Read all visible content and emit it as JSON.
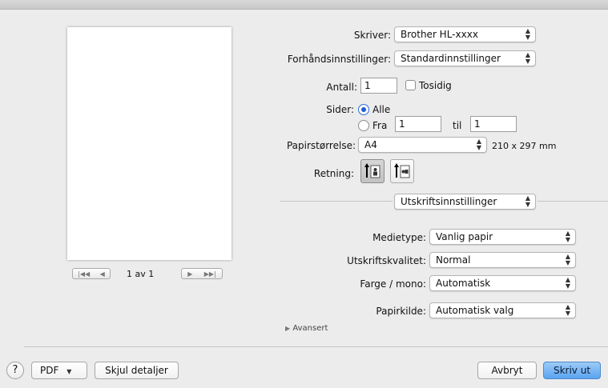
{
  "preview": {
    "page_indicator": "1 av 1",
    "first_label": "|◀◀",
    "prev_label": "◀",
    "next_label": "▶",
    "last_label": "▶▶|"
  },
  "printer": {
    "label": "Skriver:",
    "value": "Brother HL-xxxx"
  },
  "presets": {
    "label": "Forhåndsinnstillinger:",
    "value": "Standardinnstillinger"
  },
  "copies": {
    "label": "Antall:",
    "value": "1",
    "duplex_label": "Tosidig",
    "duplex_checked": false
  },
  "pages": {
    "label": "Sider:",
    "all_label": "Alle",
    "from_label": "Fra",
    "from_value": "1",
    "to_label": "til",
    "to_value": "1",
    "selected": "all"
  },
  "paper_size": {
    "label": "Papirstørrelse:",
    "value": "A4",
    "dimensions": "210 x 297 mm"
  },
  "orientation": {
    "label": "Retning:",
    "selected": "portrait"
  },
  "section": {
    "value": "Utskriftsinnstillinger"
  },
  "media_type": {
    "label": "Medietype:",
    "value": "Vanlig papir"
  },
  "quality": {
    "label": "Utskriftskvalitet:",
    "value": "Normal"
  },
  "color_mode": {
    "label": "Farge / mono:",
    "value": "Automatisk"
  },
  "paper_source": {
    "label": "Papirkilde:",
    "value": "Automatisk valg"
  },
  "advanced": {
    "label": "Avansert"
  },
  "footer": {
    "help_label": "?",
    "pdf_label": "PDF",
    "hide_details_label": "Skjul detaljer",
    "cancel_label": "Avbryt",
    "print_label": "Skriv ut"
  },
  "colors": {
    "accent": "#5aa4f0",
    "background": "#ececec"
  },
  "icons": {
    "popup_arrows": "up-down-chevron-icon",
    "pdf_dropdown": "triangle-down-icon",
    "disclosure": "triangle-right-icon"
  }
}
